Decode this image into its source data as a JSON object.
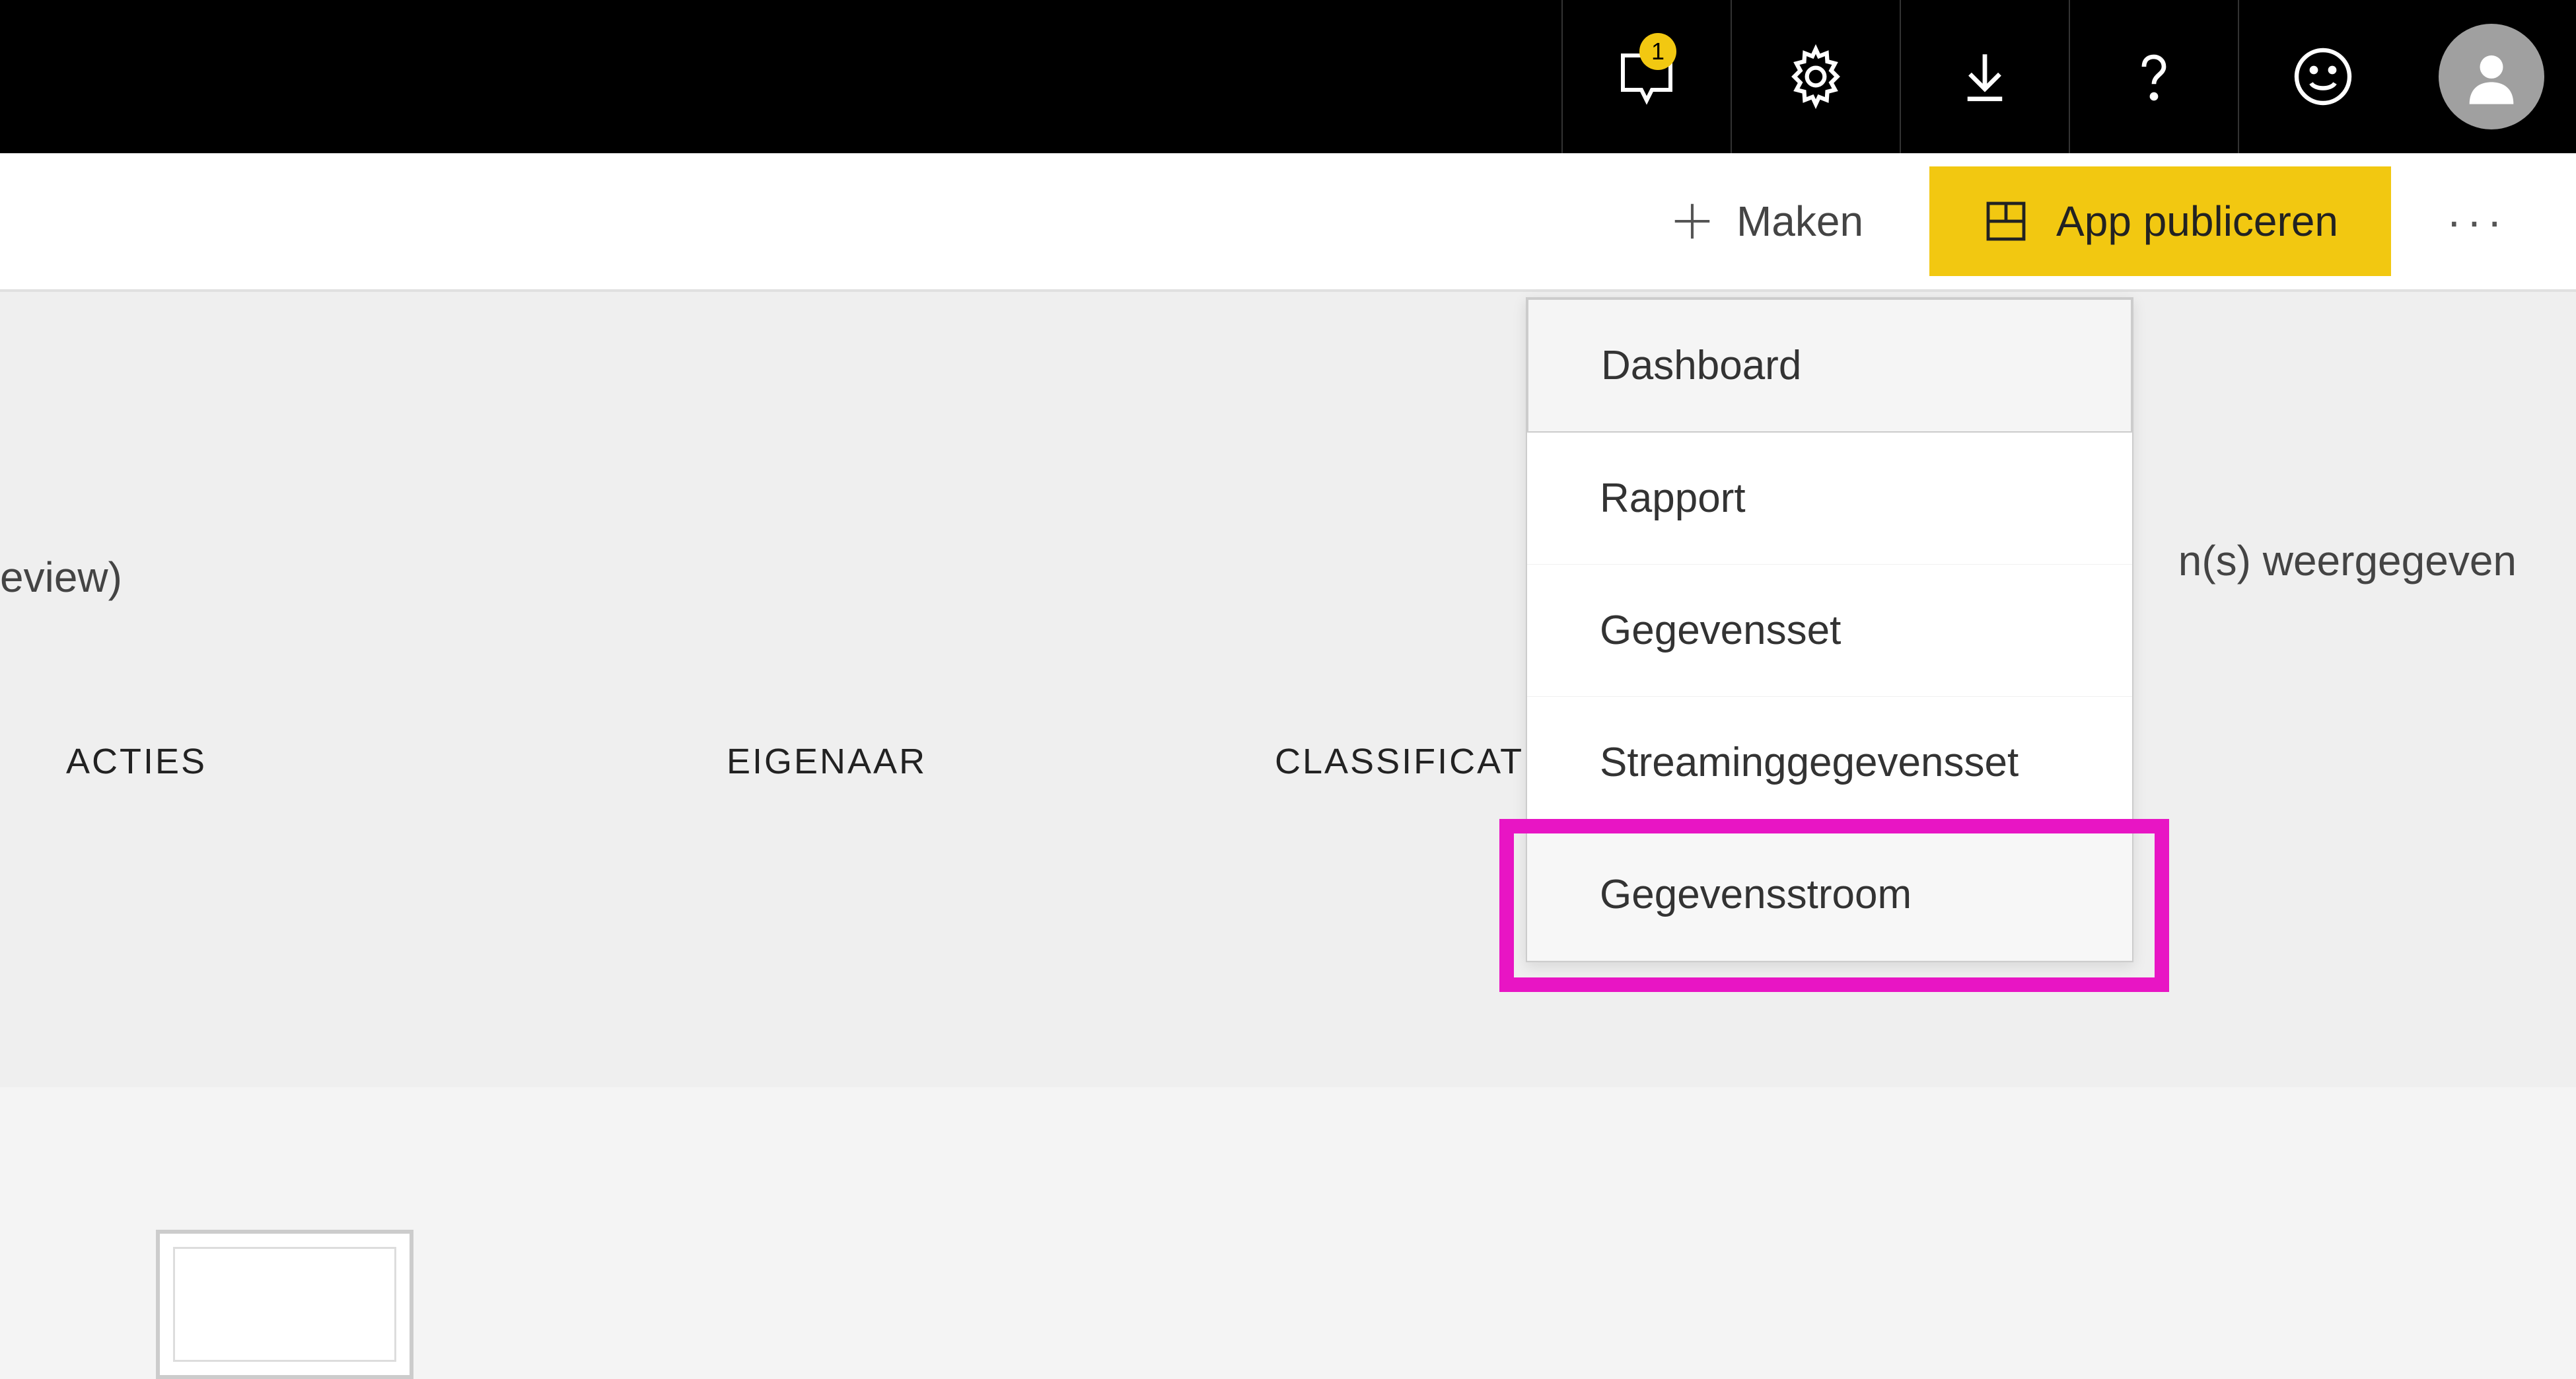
{
  "top_nav": {
    "notification_count": "1"
  },
  "toolbar": {
    "create_label": "Maken",
    "publish_label": "App publiceren",
    "more_label": "···"
  },
  "content": {
    "preview_fragment": "eview)",
    "items_shown_fragment": "n(s) weergegeven",
    "columns": {
      "acties": "ACTIES",
      "eigenaar": "EIGENAAR",
      "classificat": "CLASSIFICAT"
    }
  },
  "dropdown": {
    "items": [
      {
        "label": "Dashboard"
      },
      {
        "label": "Rapport"
      },
      {
        "label": "Gegevensset"
      },
      {
        "label": "Streaminggegevensset"
      },
      {
        "label": "Gegevensstroom"
      }
    ]
  }
}
